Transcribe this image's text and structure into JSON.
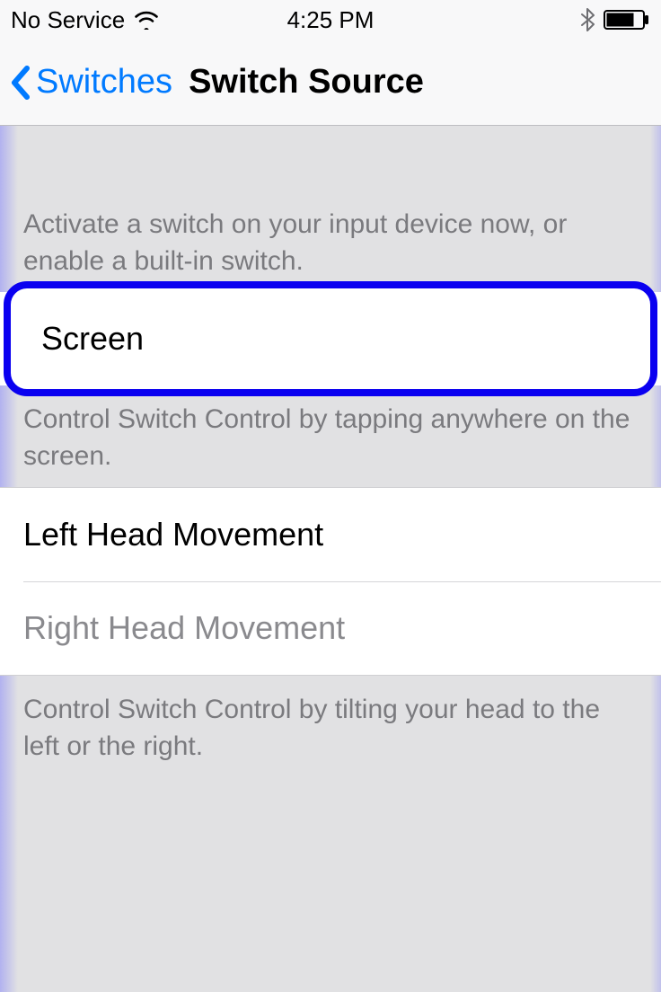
{
  "statusBar": {
    "carrier": "No Service",
    "time": "4:25 PM"
  },
  "nav": {
    "backLabel": "Switches",
    "title": "Switch Source"
  },
  "section1": {
    "header": "Activate a switch on your input device now, or enable a built-in switch.",
    "items": [
      {
        "label": "Screen"
      }
    ],
    "footer": "Control Switch Control by tapping anywhere on the screen."
  },
  "section2": {
    "items": [
      {
        "label": "Left Head Movement"
      },
      {
        "label": "Right Head Movement"
      }
    ],
    "footer": "Control Switch Control by tilting your head to the left or the right."
  }
}
